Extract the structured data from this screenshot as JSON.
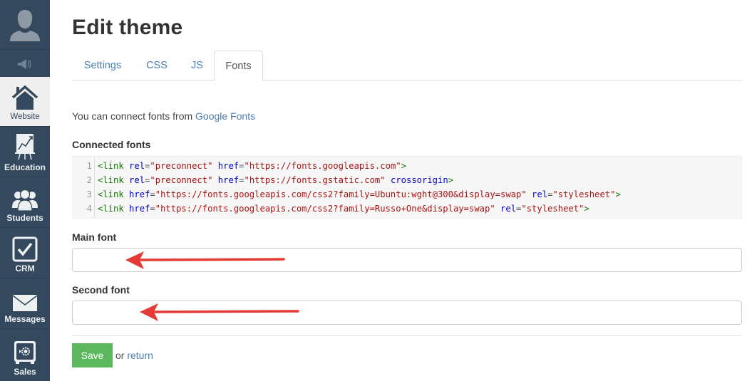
{
  "sidebar": {
    "avatar_icon": "user-silhouette-icon",
    "speaker_icon": "megaphone-icon",
    "items": [
      {
        "label": "Website",
        "icon": "house-icon",
        "active": true
      },
      {
        "label": "Education",
        "icon": "presentation-chart-icon",
        "active": false
      },
      {
        "label": "Students",
        "icon": "users-group-icon",
        "active": false
      },
      {
        "label": "CRM",
        "icon": "checkbox-icon",
        "active": false
      },
      {
        "label": "Messages",
        "icon": "envelope-icon",
        "active": false
      },
      {
        "label": "Sales",
        "icon": "safe-icon",
        "active": false
      }
    ]
  },
  "page": {
    "title": "Edit theme",
    "tabs": [
      {
        "label": "Settings",
        "active": false
      },
      {
        "label": "CSS",
        "active": false
      },
      {
        "label": "JS",
        "active": false
      },
      {
        "label": "Fonts",
        "active": true
      }
    ],
    "intro_text": "You can connect fonts from ",
    "intro_link": "Google Fonts",
    "connected_fonts_label": "Connected fonts",
    "code_lines": [
      {
        "num": "1",
        "tokens": [
          [
            "tag",
            "<link"
          ],
          [
            "sp",
            " "
          ],
          [
            "attr",
            "rel"
          ],
          [
            "eq",
            "="
          ],
          [
            "str",
            "\"preconnect\""
          ],
          [
            "sp",
            " "
          ],
          [
            "attr",
            "href"
          ],
          [
            "eq",
            "="
          ],
          [
            "str",
            "\"https://fonts.googleapis.com\""
          ],
          [
            "punc",
            ">"
          ]
        ]
      },
      {
        "num": "2",
        "tokens": [
          [
            "tag",
            "<link"
          ],
          [
            "sp",
            " "
          ],
          [
            "attr",
            "rel"
          ],
          [
            "eq",
            "="
          ],
          [
            "str",
            "\"preconnect\""
          ],
          [
            "sp",
            " "
          ],
          [
            "attr",
            "href"
          ],
          [
            "eq",
            "="
          ],
          [
            "str",
            "\"https://fonts.gstatic.com\""
          ],
          [
            "sp",
            " "
          ],
          [
            "attr",
            "crossorigin"
          ],
          [
            "punc",
            ">"
          ]
        ]
      },
      {
        "num": "3",
        "tokens": [
          [
            "tag",
            "<link"
          ],
          [
            "sp",
            " "
          ],
          [
            "attr",
            "href"
          ],
          [
            "eq",
            "="
          ],
          [
            "str",
            "\"https://fonts.googleapis.com/css2?family=Ubuntu:wght@300&display=swap\""
          ],
          [
            "sp",
            " "
          ],
          [
            "attr",
            "rel"
          ],
          [
            "eq",
            "="
          ],
          [
            "str",
            "\"stylesheet\""
          ],
          [
            "punc",
            ">"
          ]
        ]
      },
      {
        "num": "4",
        "tokens": [
          [
            "tag",
            "<link"
          ],
          [
            "sp",
            " "
          ],
          [
            "attr",
            "href"
          ],
          [
            "eq",
            "="
          ],
          [
            "str",
            "\"https://fonts.googleapis.com/css2?family=Russo+One&display=swap\""
          ],
          [
            "sp",
            " "
          ],
          [
            "attr",
            "rel"
          ],
          [
            "eq",
            "="
          ],
          [
            "str",
            "\"stylesheet\""
          ],
          [
            "punc",
            ">"
          ]
        ]
      }
    ],
    "main_font_label": "Main font",
    "main_font_value": "",
    "second_font_label": "Second font",
    "second_font_value": "",
    "save_label": "Save",
    "or_text": "or ",
    "return_label": "return"
  },
  "annotations": {
    "arrow_color": "#e53935"
  },
  "colors": {
    "sidebar_bg": "#34495e",
    "link": "#4a7fb0",
    "save_button": "#5cb85c"
  }
}
